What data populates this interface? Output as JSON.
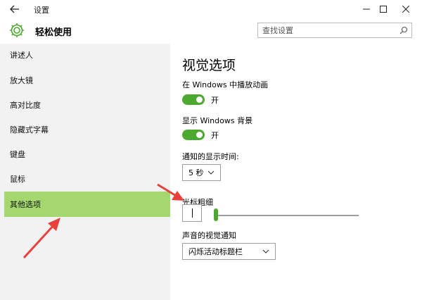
{
  "window": {
    "title": "设置",
    "controls": {
      "minimize": "−",
      "maximize": "□",
      "close": "✕"
    }
  },
  "header": {
    "app_title": "轻松使用",
    "search_placeholder": "查找设置"
  },
  "sidebar": {
    "items": [
      {
        "label": "讲述人",
        "active": false
      },
      {
        "label": "放大镜",
        "active": false
      },
      {
        "label": "高对比度",
        "active": false
      },
      {
        "label": "隐藏式字幕",
        "active": false
      },
      {
        "label": "键盘",
        "active": false
      },
      {
        "label": "鼠标",
        "active": false
      },
      {
        "label": "其他选项",
        "active": true
      }
    ]
  },
  "content": {
    "section_title": "视觉选项",
    "animations": {
      "label": "在 Windows 中播放动画",
      "state": "开",
      "on": true
    },
    "background": {
      "label": "显示 Windows 背景",
      "state": "开",
      "on": true
    },
    "notifications": {
      "label": "通知的显示时间:",
      "value": "5 秒"
    },
    "cursor_thickness": {
      "label": "光标粗细",
      "value_fraction": 0.0
    },
    "sound_visual": {
      "label": "声音的视觉通知",
      "value": "闪烁活动标题栏"
    }
  },
  "colors": {
    "accent_green": "#4da82f",
    "sidebar_selected": "#a4d86e",
    "arrow_red": "#e8413c"
  }
}
